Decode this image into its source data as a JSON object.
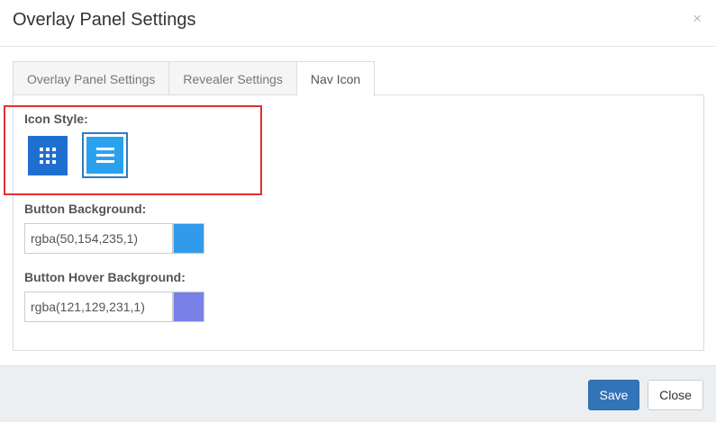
{
  "dialog": {
    "title": "Overlay Panel Settings",
    "close_symbol": "×"
  },
  "tabs": [
    {
      "label": "Overlay Panel Settings",
      "active": false
    },
    {
      "label": "Revealer Settings",
      "active": false
    },
    {
      "label": "Nav Icon",
      "active": true
    }
  ],
  "nav_icon": {
    "icon_style_label": "Icon Style:",
    "styles": [
      {
        "name": "grid-icon",
        "selected": false,
        "color": "#1f6fd0"
      },
      {
        "name": "hamburger-icon",
        "selected": true,
        "color": "#2aa1ee"
      }
    ],
    "button_background_label": "Button Background:",
    "button_background_value": "rgba(50,154,235,1)",
    "button_background_color": "#329aeb",
    "button_hover_background_label": "Button Hover Background:",
    "button_hover_background_value": "rgba(121,129,231,1)",
    "button_hover_background_color": "#7981e7"
  },
  "footer": {
    "save_label": "Save",
    "close_label": "Close"
  }
}
